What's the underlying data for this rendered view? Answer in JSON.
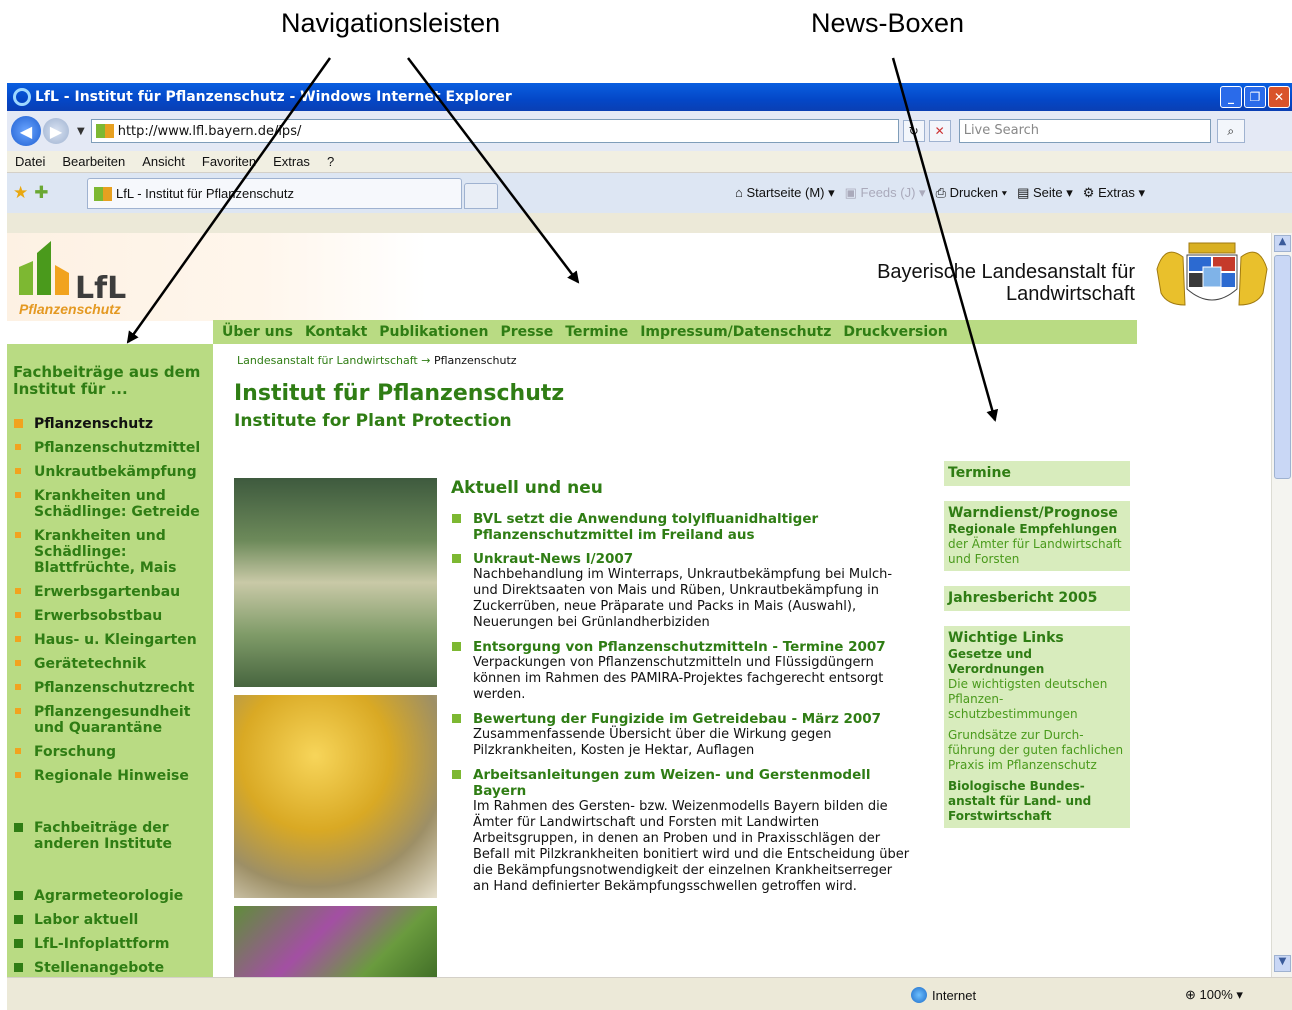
{
  "annotations": {
    "nav_label": "Navigationsleisten",
    "news_label": "News-Boxen"
  },
  "browser": {
    "title": "LfL - Institut für Pflanzenschutz - Windows Internet Explorer",
    "url": "http://www.lfl.bayern.de/ips/",
    "search_placeholder": "Live Search",
    "menu": [
      "Datei",
      "Bearbeiten",
      "Ansicht",
      "Favoriten",
      "Extras",
      "?"
    ],
    "tab_title": "LfL - Institut für Pflanzenschutz",
    "commands": {
      "home": "Startseite (M)",
      "feeds": "Feeds (J)",
      "print": "Drucken",
      "page": "Seite",
      "tools": "Extras"
    },
    "status_zone": "Internet",
    "zoom": "100%"
  },
  "header": {
    "logo_text": "LfL",
    "logo_sub": "Pflanzenschutz",
    "institution_line1": "Bayerische Landesanstalt für",
    "institution_line2": "Landwirtschaft"
  },
  "topnav": [
    "Über uns",
    "Kontakt",
    "Publikationen",
    "Presse",
    "Termine",
    "Impressum/Datenschutz",
    "Druckversion"
  ],
  "leftnav": {
    "heading": "Fachbeiträge aus dem Institut für ...",
    "items": [
      "Pflanzenschutz",
      "Pflanzenschutzmittel",
      "Unkrautbekämpfung",
      "Krankheiten und Schädlinge: Getreide",
      "Krankheiten und Schädlinge: Blattfrüchte, Mais",
      "Erwerbsgartenbau",
      "Erwerbsobstbau",
      "Haus- u. Kleingarten",
      "Gerätetechnik",
      "Pflanzenschutzrecht",
      "Pflanzengesundheit und Quarantäne",
      "Forschung",
      "Regionale Hinweise"
    ],
    "other_institutes": "Fachbeiträge der anderen Institute",
    "extra_items": [
      "Agrarmeteorologie",
      "Labor aktuell",
      "LfL-Infoplattform",
      "Stellenangebote"
    ]
  },
  "breadcrumb": {
    "parent": "Landesanstalt für Landwirtschaft",
    "separator": "→",
    "current": "Pflanzenschutz"
  },
  "main": {
    "title": "Institut für Pflanzenschutz",
    "subtitle": "Institute for Plant Protection",
    "news_heading": "Aktuell und neu",
    "news": [
      {
        "title": "BVL setzt die Anwendung tolylfluanidhaltiger Pflanzenschutzmittel im Freiland aus",
        "text": ""
      },
      {
        "title": "Unkraut-News I/2007",
        "text": "Nachbehandlung im Winterraps, Unkrautbekämpfung bei Mulch- und Direktsaaten von Mais und Rüben, Unkrautbekämpfung in Zuckerrüben, neue Präparate und Packs in Mais (Auswahl), Neuerungen bei Grünlandherbiziden"
      },
      {
        "title": "Entsorgung von Pflanzenschutzmitteln - Termine 2007",
        "text": "Verpackungen von Pflanzenschutzmitteln und Flüssigdüngern können im Rahmen des PAMIRA-Projektes fachgerecht entsorgt werden."
      },
      {
        "title": "Bewertung der Fungizide im Getreidebau - März 2007",
        "text": "Zusammenfassende Übersicht über die Wirkung gegen Pilzkrankheiten, Kosten je Hektar, Auflagen"
      },
      {
        "title": "Arbeitsanleitungen zum Weizen- und Gerstenmodell Bayern",
        "text": "Im Rahmen des Gersten- bzw. Weizenmodells Bayern bilden die Ämter für Landwirtschaft und Forsten mit Landwirten Arbeitsgruppen, in denen an Proben und in Praxisschlägen der Befall mit Pilzkrankheiten bonitiert wird und die Entscheidung über die Bekämpfungsnotwendigkeit der einzelnen Krankheitserreger an Hand definierter Bekämpfungsschwellen getroffen wird."
      }
    ]
  },
  "rightboxes": {
    "termine": "Termine",
    "warndienst": {
      "title": "Warndienst/Prognose",
      "link": "Regionale Empfehlungen",
      "text": "der Ämter für Landwirtschaft und Forsten"
    },
    "jahresbericht": "Jahresbericht 2005",
    "links": {
      "title": "Wichtige Links",
      "gesetze": "Gesetze und Verordnungen",
      "gesetze_text": "Die wichtigsten deutschen Pflanzen-schutzbestimmungen",
      "grundsaetze": "Grundsätze zur Durch-führung der guten fachlichen Praxis im Pflanzenschutz",
      "bba": "Biologische Bundes-anstalt für Land- und Forstwirtschaft"
    }
  }
}
